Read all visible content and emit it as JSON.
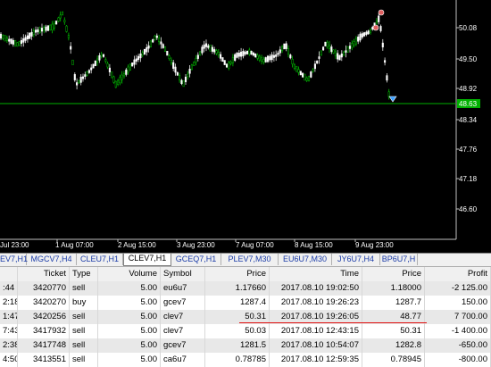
{
  "chart": {
    "price_labels": [
      "50.08",
      "49.50",
      "48.92",
      "48.34",
      "47.76",
      "47.18",
      "46.60"
    ],
    "current_price": "48.63",
    "time_labels": [
      "Jul 23:00",
      "1 Aug 07:00",
      "2 Aug 15:00",
      "3 Aug 23:00",
      "7 Aug 07:00",
      "8 Aug 15:00",
      "9 Aug 23:00"
    ],
    "colors": {
      "background": "#000000",
      "candle": "#ffffff",
      "candle_bull": "#00c000",
      "level_line": "#00b000",
      "price_tag": "#00b000",
      "arrow": "#e03030"
    }
  },
  "tabs": {
    "items": [
      "EV7,H1",
      "MGCV7,H4",
      "CLEU7,H1",
      "CLEV7,H1",
      "GCEQ7,H1",
      "PLEV7,M30",
      "EU6U7,M30",
      "JY6U7,H4",
      "BP6U7,H"
    ],
    "active_index": 3
  },
  "table": {
    "headers": [
      "",
      "Ticket",
      "Type",
      "Volume",
      "Symbol",
      "Price",
      "Time",
      "Price",
      "Profit"
    ],
    "rows": [
      [
        ":44",
        "3420770",
        "sell",
        "5.00",
        "eu6u7",
        "1.17660",
        "2017.08.10 19:02:50",
        "1.18000",
        "-2 125.00"
      ],
      [
        "2:18",
        "3420270",
        "buy",
        "5.00",
        "gcev7",
        "1287.4",
        "2017.08.10 19:26:23",
        "1287.7",
        "150.00"
      ],
      [
        "1:47",
        "3420256",
        "sell",
        "5.00",
        "clev7",
        "50.31",
        "2017.08.10 19:26:05",
        "48.77",
        "7 700.00"
      ],
      [
        "7:43",
        "3417932",
        "sell",
        "5.00",
        "clev7",
        "50.03",
        "2017.08.10 12:43:15",
        "50.31",
        "-1 400.00"
      ],
      [
        "2:38",
        "3417748",
        "sell",
        "5.00",
        "gcev7",
        "1281.5",
        "2017.08.10 10:54:07",
        "1282.8",
        "-650.00"
      ],
      [
        "4:50",
        "3413551",
        "sell",
        "5.00",
        "ca6u7",
        "0.78785",
        "2017.08.10 12:59:35",
        "0.78945",
        "-800.00"
      ]
    ]
  }
}
